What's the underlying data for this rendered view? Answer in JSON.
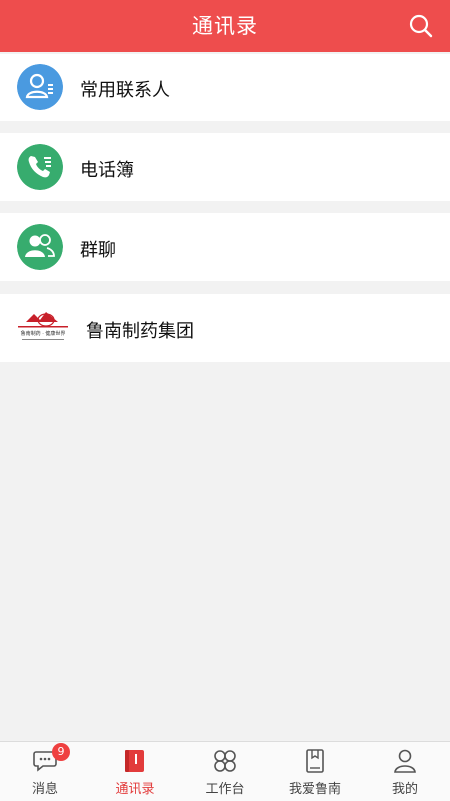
{
  "header": {
    "title": "通讯录",
    "search_icon": "search-icon"
  },
  "colors": {
    "brand": "#ee4d4d",
    "blue": "#4a9ae0",
    "green": "#37ac6e",
    "tab_active": "#e23b3b"
  },
  "rows": [
    {
      "label": "常用联系人",
      "icon": "frequent-contacts-icon"
    },
    {
      "label": "电话簿",
      "icon": "phone-book-icon"
    },
    {
      "label": "群聊",
      "icon": "group-chat-icon"
    },
    {
      "label": "鲁南制药集团",
      "icon": "lunan-logo"
    }
  ],
  "logo": {
    "text": "鲁南制药 · 健康世界"
  },
  "tabs": [
    {
      "label": "消息",
      "icon": "message-icon",
      "badge": "9"
    },
    {
      "label": "通讯录",
      "icon": "contacts-book-icon",
      "active": true
    },
    {
      "label": "工作台",
      "icon": "workbench-icon"
    },
    {
      "label": "我爱鲁南",
      "icon": "bookmark-book-icon"
    },
    {
      "label": "我的",
      "icon": "profile-icon"
    }
  ]
}
